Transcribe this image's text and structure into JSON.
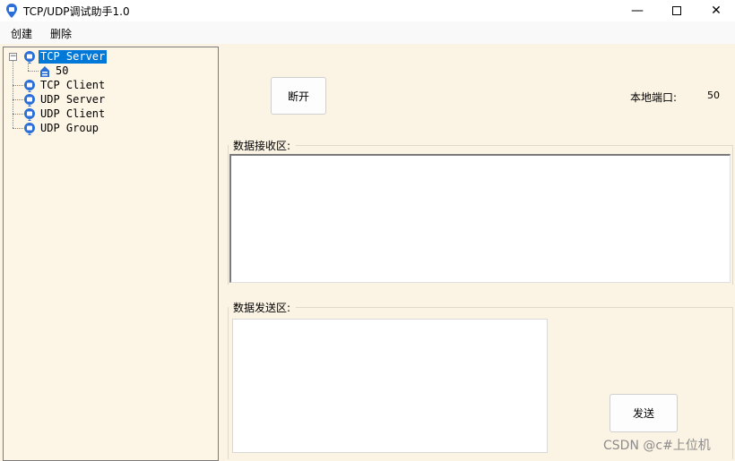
{
  "window": {
    "title": "TCP/UDP调试助手1.0",
    "minimize_glyph": "—",
    "maximize_glyph": "☐",
    "close_glyph": "✕"
  },
  "menu": {
    "create": "创建",
    "delete": "删除"
  },
  "tree": {
    "nodes": [
      {
        "label": "TCP Server",
        "selected": true,
        "expanded": true,
        "icon": "network-icon"
      },
      {
        "label": "50",
        "icon": "connection-icon"
      },
      {
        "label": "TCP Client",
        "icon": "network-icon"
      },
      {
        "label": "UDP Server",
        "icon": "network-icon"
      },
      {
        "label": "UDP Client",
        "icon": "network-icon"
      },
      {
        "label": "UDP Group",
        "icon": "network-icon"
      }
    ]
  },
  "panel": {
    "disconnect_label": "断开",
    "local_port_label": "本地端口:",
    "local_port_value": "50",
    "receive_label": "数据接收区:",
    "send_area_label": "数据发送区:",
    "send_button_label": "发送"
  },
  "watermark": "CSDN @c#上位机",
  "colors": {
    "background": "#fbf3e3",
    "selection": "#0078d7",
    "icon_blue": "#2b6fd6"
  }
}
